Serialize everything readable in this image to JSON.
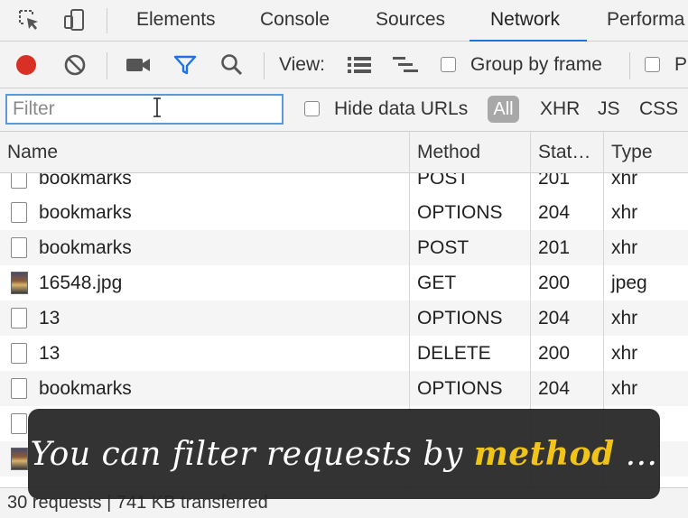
{
  "tabs": [
    {
      "label": "Elements"
    },
    {
      "label": "Console"
    },
    {
      "label": "Sources"
    },
    {
      "label": "Network",
      "active": true
    },
    {
      "label": "Performa"
    }
  ],
  "toolbar": {
    "view_label": "View:",
    "group_by_frame_label": "Group by frame",
    "cut_label": "P",
    "record_color": "#d93025",
    "filter_icon_color": "#1a73e8"
  },
  "filterbar": {
    "filter_placeholder": "Filter",
    "filter_value": "",
    "hide_data_urls_label": "Hide data URLs",
    "chips": [
      "All",
      "XHR",
      "JS",
      "CSS"
    ]
  },
  "table": {
    "columns": [
      "Name",
      "Method",
      "Stat…",
      "Type"
    ],
    "rows": [
      {
        "name": "bookmarks",
        "method": "POST",
        "status": "201",
        "type": "xhr",
        "icon": "file"
      },
      {
        "name": "bookmarks",
        "method": "OPTIONS",
        "status": "204",
        "type": "xhr",
        "icon": "file"
      },
      {
        "name": "bookmarks",
        "method": "POST",
        "status": "201",
        "type": "xhr",
        "icon": "file"
      },
      {
        "name": "16548.jpg",
        "method": "GET",
        "status": "200",
        "type": "jpeg",
        "icon": "image"
      },
      {
        "name": "13",
        "method": "OPTIONS",
        "status": "204",
        "type": "xhr",
        "icon": "file"
      },
      {
        "name": "13",
        "method": "DELETE",
        "status": "200",
        "type": "xhr",
        "icon": "file"
      },
      {
        "name": "bookmarks",
        "method": "OPTIONS",
        "status": "204",
        "type": "xhr",
        "icon": "file"
      },
      {
        "name": "",
        "method": "",
        "status": "",
        "type": "",
        "icon": "file"
      },
      {
        "name": "",
        "method": "",
        "status": "",
        "type": "",
        "icon": "image"
      }
    ]
  },
  "status": {
    "summary": "30 requests | 741 KB transferred"
  },
  "overlay": {
    "caption_prefix": "You can filter requests by ",
    "caption_highlight": "method",
    "caption_suffix": " ...",
    "highlight_color": "#f0c419"
  }
}
